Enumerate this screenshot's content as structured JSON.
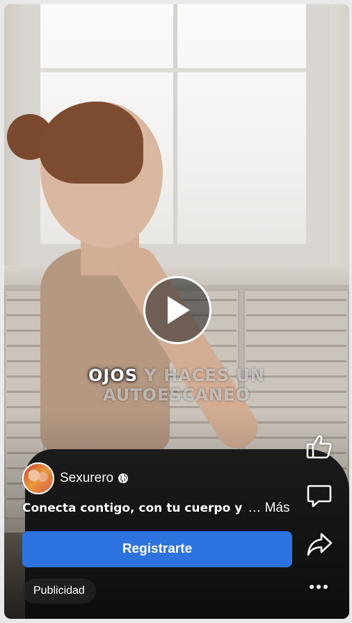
{
  "caption": {
    "highlight": "OJOS",
    "line1_rest": " Y HACES UN",
    "line2": "AUTOESCANEO"
  },
  "post": {
    "author_name": "Sexurero",
    "audience_icon": "globe-icon",
    "description": "Conecta contigo, con tu cuerpo y",
    "more_label": "… Más"
  },
  "cta": {
    "label": "Registrarte"
  },
  "sponsored_label": "Publicidad",
  "actions": [
    {
      "name": "like",
      "icon": "thumbs-up-icon"
    },
    {
      "name": "comment",
      "icon": "comment-icon"
    },
    {
      "name": "share",
      "icon": "share-icon"
    },
    {
      "name": "more",
      "icon": "more-dots-icon"
    }
  ],
  "colors": {
    "cta": "#2d73e0",
    "overlay_text": "#ffffff"
  }
}
